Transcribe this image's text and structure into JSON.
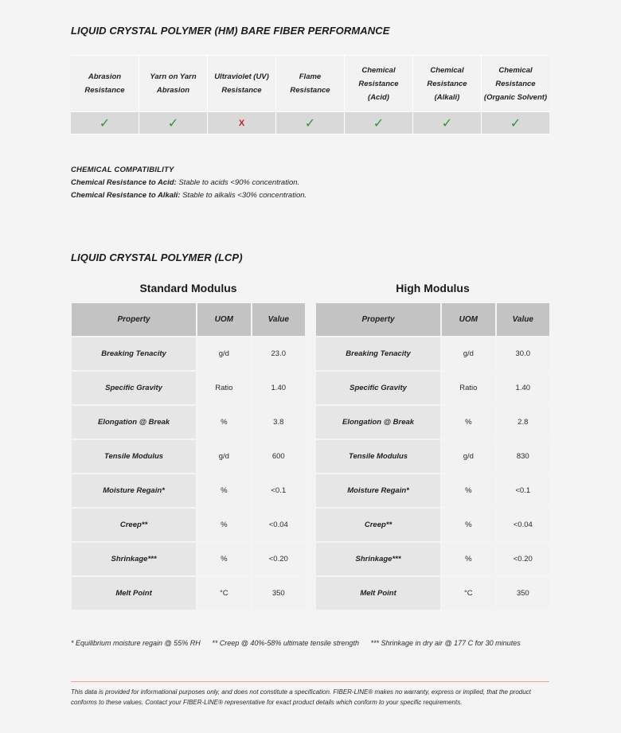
{
  "performance": {
    "title": "LIQUID CRYSTAL POLYMER (HM) BARE FIBER PERFORMANCE",
    "columns": [
      {
        "label_lines": [
          "Abrasion",
          "Resistance"
        ],
        "result": "pass",
        "symbol": "✓"
      },
      {
        "label_lines": [
          "Yarn on Yarn",
          "Abrasion"
        ],
        "result": "pass",
        "symbol": "✓"
      },
      {
        "label_lines": [
          "Ultraviolet (UV)",
          "Resistance"
        ],
        "result": "fail",
        "symbol": "X"
      },
      {
        "label_lines": [
          "Flame",
          "Resistance"
        ],
        "result": "pass",
        "symbol": "✓"
      },
      {
        "label_lines": [
          "Chemical",
          "Resistance",
          "(Acid)"
        ],
        "result": "pass",
        "symbol": "✓"
      },
      {
        "label_lines": [
          "Chemical",
          "Resistance",
          "(Alkali)"
        ],
        "result": "pass",
        "symbol": "✓"
      },
      {
        "label_lines": [
          "Chemical",
          "Resistance",
          "(Organic Solvent)"
        ],
        "result": "pass",
        "symbol": "✓"
      }
    ],
    "colors": {
      "pass": "#2a9a3a",
      "fail": "#c0202a"
    }
  },
  "chemical_compatibility": {
    "heading": "CHEMICAL COMPATIBILITY",
    "lines": [
      {
        "label": "Chemical Resistance to Acid:",
        "text": " Stable to acids <90% concentration."
      },
      {
        "label": "Chemical Resistance to Alkali:",
        "text": " Stable to alkalis <30% concentration."
      }
    ]
  },
  "lcp": {
    "title": "LIQUID CRYSTAL POLYMER (LCP)",
    "headers": [
      "Property",
      "UOM",
      "Value"
    ],
    "tables": [
      {
        "title": "Standard Modulus",
        "rows": [
          [
            "Breaking Tenacity",
            "g/d",
            "23.0"
          ],
          [
            "Specific Gravity",
            "Ratio",
            "1.40"
          ],
          [
            "Elongation @ Break",
            "%",
            "3.8"
          ],
          [
            "Tensile Modulus",
            "g/d",
            "600"
          ],
          [
            "Moisture Regain*",
            "%",
            "<0.1"
          ],
          [
            "Creep**",
            "%",
            "<0.04"
          ],
          [
            "Shrinkage***",
            "%",
            "<0.20"
          ],
          [
            "Melt Point",
            "°C",
            "350"
          ]
        ]
      },
      {
        "title": "High Modulus",
        "rows": [
          [
            "Breaking Tenacity",
            "g/d",
            "30.0"
          ],
          [
            "Specific Gravity",
            "Ratio",
            "1.40"
          ],
          [
            "Elongation @ Break",
            "%",
            "2.8"
          ],
          [
            "Tensile Modulus",
            "g/d",
            "830"
          ],
          [
            "Moisture Regain*",
            "%",
            "<0.1"
          ],
          [
            "Creep**",
            "%",
            "<0.04"
          ],
          [
            "Shrinkage***",
            "%",
            "<0.20"
          ],
          [
            "Melt Point",
            "°C",
            "350"
          ]
        ]
      }
    ]
  },
  "footnotes": [
    "* Equilibrium moisture regain @ 55% RH",
    "** Creep @ 40%-58% ultimate tensile strength",
    "*** Shrinkage in dry air @ 177 C for 30 minutes"
  ],
  "disclaimer": "This data is provided for informational purposes only, and does not constitute a specification. FIBER-LINE® makes no warranty, express or implied, that the product conforms to these values. Contact your FIBER-LINE® representative for exact product details which conform to your specific requirements.",
  "accent_color": "#e8a58a"
}
